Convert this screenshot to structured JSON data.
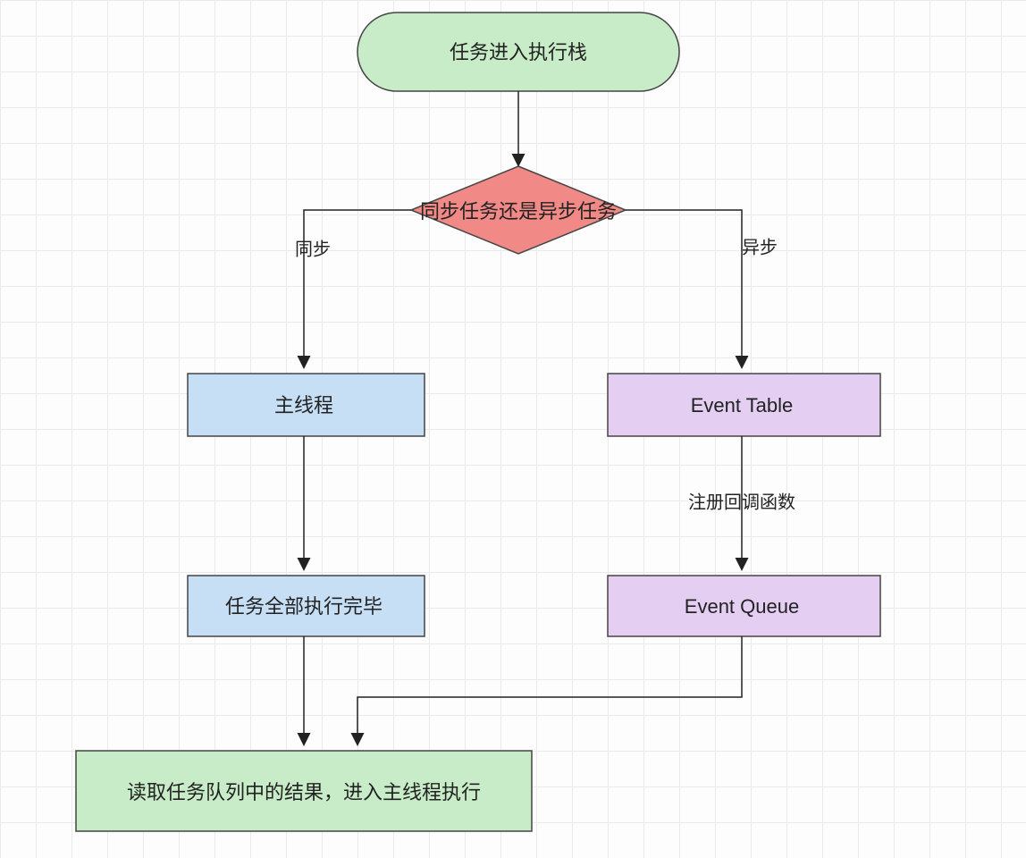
{
  "diagram": {
    "nodes": {
      "start": {
        "label": "任务进入执行栈"
      },
      "decision": {
        "label": "同步任务还是异步任务"
      },
      "mainThread": {
        "label": "主线程"
      },
      "eventTable": {
        "label": "Event Table"
      },
      "tasksDone": {
        "label": "任务全部执行完毕"
      },
      "eventQueue": {
        "label": "Event Queue"
      },
      "readQueue": {
        "label": "读取任务队列中的结果，进入主线程执行"
      }
    },
    "edges": {
      "sync": {
        "label": "同步"
      },
      "async": {
        "label": "异步"
      },
      "registerCallback": {
        "label": "注册回调函数"
      }
    },
    "colors": {
      "green": "#c8ecc8",
      "red": "#f18a86",
      "blue": "#c6dff5",
      "purple": "#e4cff3"
    }
  }
}
